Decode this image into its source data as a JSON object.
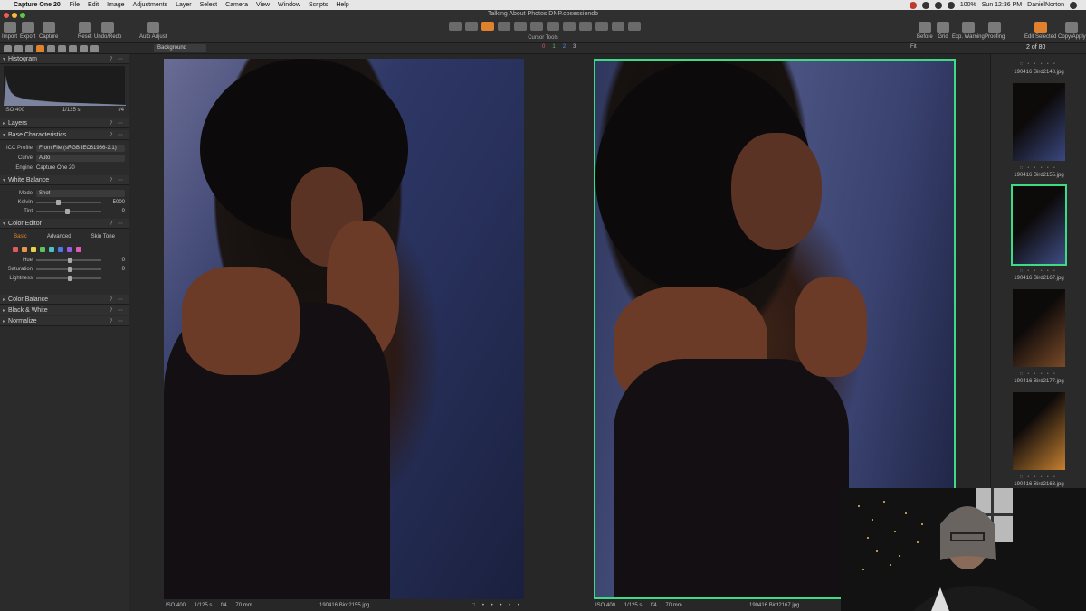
{
  "menubar": {
    "app_name": "Capture One 20",
    "menus": [
      "File",
      "Edit",
      "Image",
      "Adjustments",
      "Layer",
      "Select",
      "Camera",
      "View",
      "Window",
      "Scripts",
      "Help"
    ],
    "battery": "100%",
    "clock": "Sun 12:36 PM",
    "user": "DanielNorton"
  },
  "window": {
    "title": "Talking About Photos DNP.cosessiondb"
  },
  "toolbar": {
    "import": "Import",
    "export": "Export",
    "capture": "Capture",
    "reset": "Reset",
    "undo_redo": "Undo/Redo",
    "auto_adjust": "Auto Adjust",
    "cursor_tools": "Cursor Tools",
    "before": "Before",
    "grid": "Grid",
    "exp_warning": "Exp. Warning",
    "proofing": "Proofing",
    "edit_selected": "Edit Selected",
    "copy_apply": "Copy/Apply"
  },
  "subbar": {
    "background_select": "Background",
    "ratings": [
      "0",
      "1",
      "2",
      "3"
    ],
    "fit": "Fit",
    "counter": "2 of 80"
  },
  "left_panel": {
    "histogram": {
      "title": "Histogram",
      "iso": "ISO 400",
      "shutter": "1/125 s",
      "aperture": "f/4"
    },
    "layers": {
      "title": "Layers"
    },
    "base": {
      "title": "Base Characteristics",
      "icc_label": "ICC Profile",
      "icc_value": "From File (sRGB IEC61966-2.1)",
      "curve_label": "Curve",
      "curve_value": "Auto",
      "engine_label": "Engine",
      "engine_value": "Capture One 20"
    },
    "white_balance": {
      "title": "White Balance",
      "mode_label": "Mode",
      "mode_value": "Shot",
      "kelvin_label": "Kelvin",
      "kelvin_value": "5000",
      "tint_label": "Tint",
      "tint_value": "0"
    },
    "color_editor": {
      "title": "Color Editor",
      "tabs": [
        "Basic",
        "Advanced",
        "Skin Tone"
      ],
      "hue_label": "Hue",
      "hue_value": "0",
      "saturation_label": "Saturation",
      "saturation_value": "0",
      "lightness_label": "Lightness",
      "swatches": [
        "#e05a5a",
        "#e8974a",
        "#e8d24a",
        "#5ec25e",
        "#4ac2c2",
        "#4a7ae8",
        "#9a5ae8",
        "#e05ab4"
      ]
    },
    "color_balance": {
      "title": "Color Balance"
    },
    "black_white": {
      "title": "Black & White"
    },
    "normalize": {
      "title": "Normalize"
    }
  },
  "viewer": {
    "left": {
      "iso": "ISO 400",
      "shutter": "1/125 s",
      "aperture": "f/4",
      "focal": "70 mm",
      "filename": "190416 Bird2155.jpg"
    },
    "right": {
      "iso": "ISO 400",
      "shutter": "1/125 s",
      "aperture": "f/4",
      "focal": "70 mm",
      "filename": "190416 Bird2167.jpg"
    }
  },
  "filmstrip": {
    "thumbs": [
      {
        "caption": "190416 Bird2148.jpg"
      },
      {
        "caption": "190416 Bird2155.jpg"
      },
      {
        "caption": "190416 Bird2167.jpg"
      },
      {
        "caption": "190416 Bird2177.jpg"
      },
      {
        "caption": "190416 Bird2163.jpg"
      }
    ]
  },
  "accent_colors": {
    "orange": "#e0812d",
    "selection_green": "#3ddc84"
  }
}
